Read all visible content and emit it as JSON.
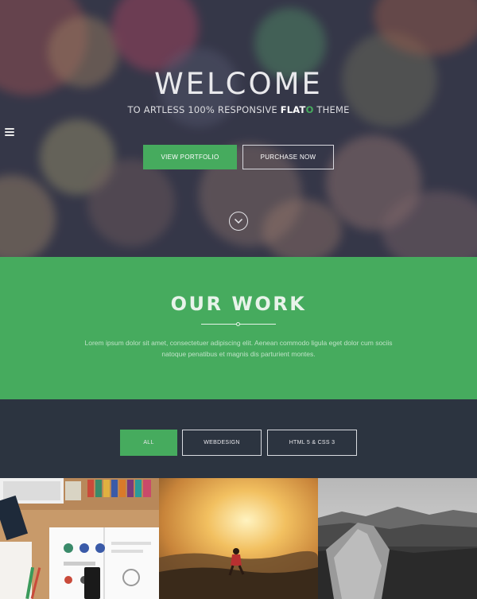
{
  "hero": {
    "title": "WELCOME",
    "subtitle_prefix": "TO ARTLESS 100% RESPONSIVE ",
    "subtitle_brand_main": "FLAT",
    "subtitle_brand_accent": "O",
    "subtitle_suffix": " THEME",
    "primary_button": "VIEW PORTFOLIO",
    "secondary_button": "PURCHASE NOW"
  },
  "work": {
    "title": "OUR WORK",
    "description": "Lorem ipsum dolor sit amet, consectetuer adipiscing elit. Aenean commodo ligula eget dolor cum sociis natoque penatibus et magnis dis parturient montes."
  },
  "filters": [
    "ALL",
    "WEBDESIGN",
    "HTML 5 & CSS 3"
  ],
  "colors": {
    "accent": "#46ab5e",
    "dark": "#2c3440"
  },
  "icons": {
    "menu": "hamburger-icon",
    "scroll": "chevron-down-circle-icon"
  }
}
